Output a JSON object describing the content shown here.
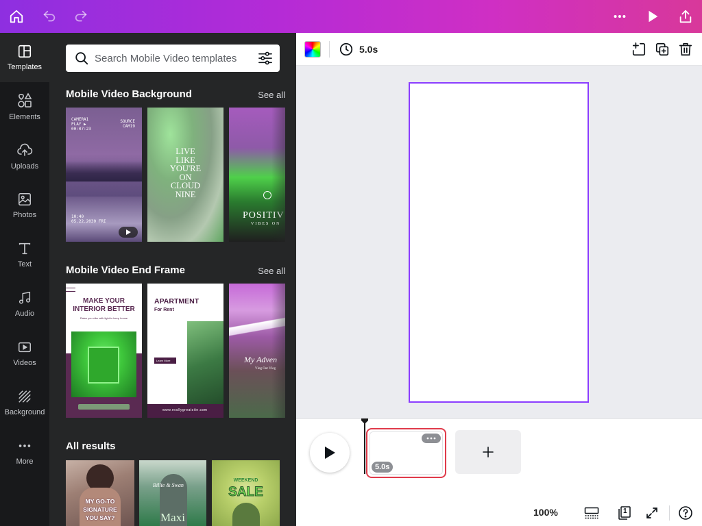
{
  "topbar": {
    "icons": [
      "home-icon",
      "undo-icon",
      "redo-icon",
      "more-icon",
      "present-icon",
      "share-icon"
    ]
  },
  "rail": {
    "items": [
      {
        "label": "Templates",
        "icon": "templates-icon",
        "active": true
      },
      {
        "label": "Elements",
        "icon": "elements-icon"
      },
      {
        "label": "Uploads",
        "icon": "uploads-icon"
      },
      {
        "label": "Photos",
        "icon": "photos-icon"
      },
      {
        "label": "Text",
        "icon": "text-icon"
      },
      {
        "label": "Audio",
        "icon": "audio-icon"
      },
      {
        "label": "Videos",
        "icon": "videos-icon"
      },
      {
        "label": "Background",
        "icon": "background-icon"
      },
      {
        "label": "More",
        "icon": "more-icon"
      }
    ]
  },
  "search": {
    "placeholder": "Search Mobile Video templates",
    "value": ""
  },
  "sections": {
    "background": {
      "title": "Mobile Video Background",
      "see_all": "See all",
      "thumbs": {
        "t1": {
          "top_left": "CAMERA1\nPLAY ▶\n00:07:23",
          "top_right": "SOURCE\nCAM19",
          "bottom": "10:40\n05.22.2030 FRI"
        },
        "t2": {
          "text": "LIVE\nLIKE\nYOU'RE\nON\nCLOUD\nNINE"
        },
        "t3": {
          "text": "POSITIV",
          "sub": "VIBES ON"
        }
      }
    },
    "end_frame": {
      "title": "Mobile Video End Frame",
      "see_all": "See all",
      "thumbs": {
        "t1": {
          "headline": "MAKE YOUR\nINTERIOR BETTER",
          "sub": "Raise you vibe with light to keep house"
        },
        "t2": {
          "headline": "APARTMENT",
          "sub": "For Rent",
          "button": "Learn More",
          "url": "www.reallygreatsite.com"
        },
        "t3": {
          "script": "My Adven",
          "sub": "Vlog Our Vlog"
        }
      }
    },
    "all_results": {
      "title": "All results",
      "thumbs": {
        "r1": {
          "text": "MY GO-TO\nSIGNATURE\nYOU SAY?"
        },
        "r2": {
          "script": "Billie & Swan",
          "text": "Maxi"
        },
        "r3": {
          "small": "WEEKEND",
          "text": "SALE"
        }
      }
    }
  },
  "editor": {
    "duration": "5.0s"
  },
  "timeline": {
    "clip_duration": "5.0s",
    "zoom": "100%",
    "page_count": "1"
  },
  "colors": {
    "accent": "#8b3dff",
    "clip_border": "#e03a4a",
    "rail_bg": "#18191b",
    "panel_bg": "#252627"
  }
}
